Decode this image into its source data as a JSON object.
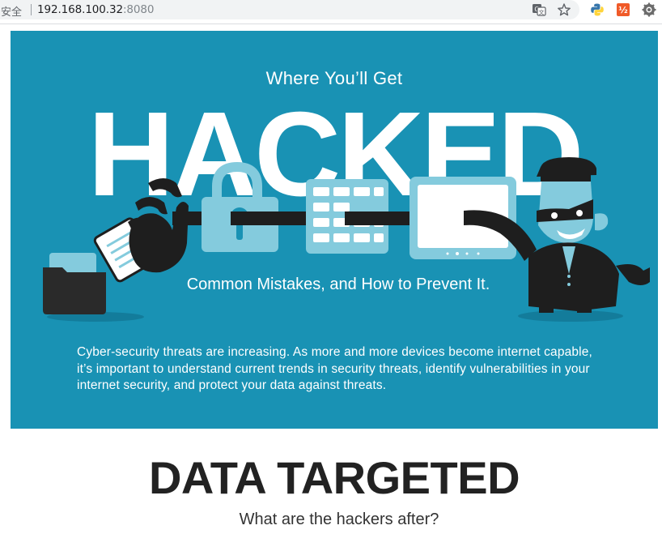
{
  "browser": {
    "security_label": "安全",
    "url_host": "192.168.100.32",
    "url_port": ":8080",
    "icons": [
      "translate-icon",
      "star-icon",
      "python-extension-icon",
      "extension-icon",
      "settings-icon"
    ]
  },
  "banner": {
    "kicker": "Where You’ll Get",
    "headline": "HACKED",
    "subtitle": "Common Mistakes, and How to Prevent It.",
    "description": "Cyber-security threats are increasing. As more and more devices become internet capable, it’s important to understand current trends in security threats, identify vulnerabilities in your internet security, and protect your data against threats.",
    "background_color": "#1992b4",
    "accent_light": "#84cbdd"
  },
  "section": {
    "title": "DATA TARGETED",
    "subtitle": "What are the hackers after?"
  }
}
